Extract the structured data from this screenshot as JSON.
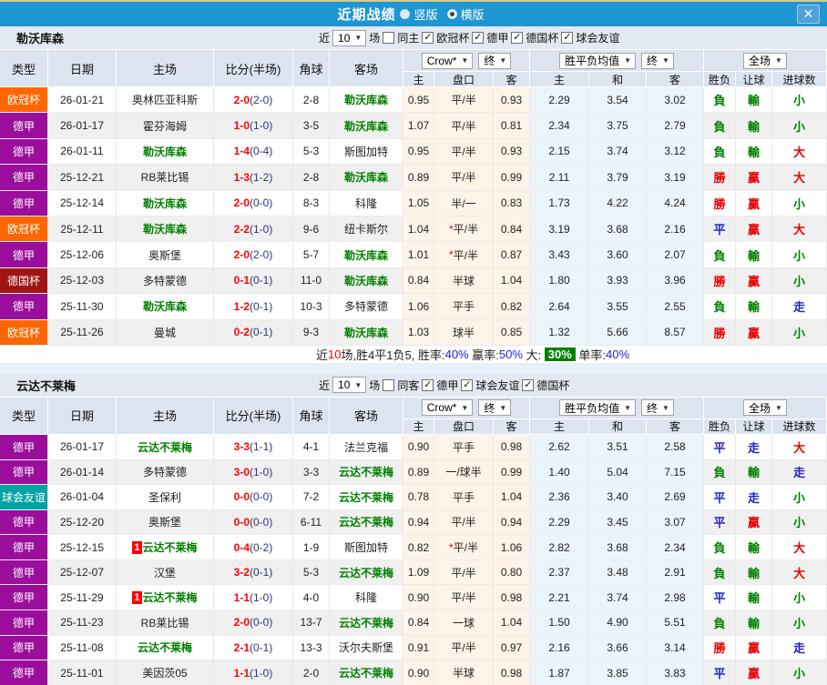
{
  "titlebar": {
    "title": "近期战绩",
    "close_glyph": "✕",
    "radios": [
      {
        "label": "竖版",
        "selected": false
      },
      {
        "label": "横版",
        "selected": true
      }
    ]
  },
  "table_columns": {
    "main": [
      "类型",
      "日期",
      "主场",
      "比分(半场)",
      "角球",
      "客场"
    ],
    "sub": [
      "主",
      "盘口",
      "客",
      "主",
      "和",
      "客",
      "胜负",
      "让球",
      "进球数"
    ]
  },
  "dropdowns": {
    "crow": "Crow*",
    "final": "终",
    "avg": "胜平负均值",
    "full": "全场"
  },
  "colors": {
    "titlebar": "#1E96D2",
    "score_red": "#FF0000",
    "half_navy": "#33337F",
    "crow_col_bg": "#FDF3E8",
    "avg_col_bg": "#EAF4FB",
    "type_colors": {
      "欧冠杯": "#FF6600",
      "德甲": "#9B0D9B",
      "德国杯": "#A01414",
      "球会友谊": "#00A3A3"
    },
    "result_colors": {
      "勝": "#E60000",
      "負": "#008000",
      "平": "#2222CC",
      "贏": "#E60000",
      "輸": "#008000",
      "走": "#2222CC",
      "大": "#E60000",
      "小": "#008000"
    }
  },
  "sections": [
    {
      "team": "勒沃库森",
      "filter": {
        "near_label": "近",
        "count": "10",
        "games_label": "场",
        "same": {
          "label": "同主",
          "checked": false
        },
        "leagues": [
          {
            "label": "欧冠杯",
            "checked": true
          },
          {
            "label": "德甲",
            "checked": true
          },
          {
            "label": "德国杯",
            "checked": true
          },
          {
            "label": "球会友谊",
            "checked": true
          }
        ]
      },
      "rows": [
        {
          "type": "欧冠杯",
          "date": "26-01-21",
          "home": "奥林匹亚科斯",
          "home_focus": false,
          "home_badge": "",
          "score": "2-0",
          "half": "(2-0)",
          "corner": "2-8",
          "away": "勒沃库森",
          "away_focus": true,
          "crow": [
            "0.95",
            "平/半",
            "0.93"
          ],
          "star": false,
          "avg": [
            "2.29",
            "3.54",
            "3.02"
          ],
          "res": "負",
          "hres": "輸",
          "goal": "小"
        },
        {
          "type": "德甲",
          "date": "26-01-17",
          "home": "霍芬海姆",
          "home_focus": false,
          "home_badge": "",
          "score": "1-0",
          "half": "(1-0)",
          "corner": "3-5",
          "away": "勒沃库森",
          "away_focus": true,
          "crow": [
            "1.07",
            "平/半",
            "0.81"
          ],
          "star": false,
          "avg": [
            "2.34",
            "3.75",
            "2.79"
          ],
          "res": "負",
          "hres": "輸",
          "goal": "小"
        },
        {
          "type": "德甲",
          "date": "26-01-11",
          "home": "勒沃库森",
          "home_focus": true,
          "home_badge": "",
          "score": "1-4",
          "half": "(0-4)",
          "corner": "5-3",
          "away": "斯图加特",
          "away_focus": false,
          "crow": [
            "0.95",
            "平/半",
            "0.93"
          ],
          "star": false,
          "avg": [
            "2.15",
            "3.74",
            "3.12"
          ],
          "res": "負",
          "hres": "輸",
          "goal": "大"
        },
        {
          "type": "德甲",
          "date": "25-12-21",
          "home": "RB莱比锡",
          "home_focus": false,
          "home_badge": "",
          "score": "1-3",
          "half": "(1-2)",
          "corner": "2-8",
          "away": "勒沃库森",
          "away_focus": true,
          "crow": [
            "0.89",
            "平/半",
            "0.99"
          ],
          "star": false,
          "avg": [
            "2.11",
            "3.79",
            "3.19"
          ],
          "res": "勝",
          "hres": "贏",
          "goal": "大"
        },
        {
          "type": "德甲",
          "date": "25-12-14",
          "home": "勒沃库森",
          "home_focus": true,
          "home_badge": "",
          "score": "2-0",
          "half": "(0-0)",
          "corner": "8-3",
          "away": "科隆",
          "away_focus": false,
          "crow": [
            "1.05",
            "半/一",
            "0.83"
          ],
          "star": false,
          "avg": [
            "1.73",
            "4.22",
            "4.24"
          ],
          "res": "勝",
          "hres": "贏",
          "goal": "小"
        },
        {
          "type": "欧冠杯",
          "date": "25-12-11",
          "home": "勒沃库森",
          "home_focus": true,
          "home_badge": "",
          "score": "2-2",
          "half": "(1-0)",
          "corner": "9-6",
          "away": "纽卡斯尔",
          "away_focus": false,
          "crow": [
            "1.04",
            "平/半",
            "0.84"
          ],
          "star": true,
          "avg": [
            "3.19",
            "3.68",
            "2.16"
          ],
          "res": "平",
          "hres": "贏",
          "goal": "大"
        },
        {
          "type": "德甲",
          "date": "25-12-06",
          "home": "奥斯堡",
          "home_focus": false,
          "home_badge": "",
          "score": "2-0",
          "half": "(2-0)",
          "corner": "5-7",
          "away": "勒沃库森",
          "away_focus": true,
          "crow": [
            "1.01",
            "平/半",
            "0.87"
          ],
          "star": true,
          "avg": [
            "3.43",
            "3.60",
            "2.07"
          ],
          "res": "負",
          "hres": "輸",
          "goal": "小"
        },
        {
          "type": "德国杯",
          "date": "25-12-03",
          "home": "多特蒙德",
          "home_focus": false,
          "home_badge": "",
          "score": "0-1",
          "half": "(0-1)",
          "corner": "11-0",
          "away": "勒沃库森",
          "away_focus": true,
          "crow": [
            "0.84",
            "半球",
            "1.04"
          ],
          "star": false,
          "avg": [
            "1.80",
            "3.93",
            "3.96"
          ],
          "res": "勝",
          "hres": "贏",
          "goal": "小"
        },
        {
          "type": "德甲",
          "date": "25-11-30",
          "home": "勒沃库森",
          "home_focus": true,
          "home_badge": "",
          "score": "1-2",
          "half": "(0-1)",
          "corner": "10-3",
          "away": "多特蒙德",
          "away_focus": false,
          "crow": [
            "1.06",
            "平手",
            "0.82"
          ],
          "star": false,
          "avg": [
            "2.64",
            "3.55",
            "2.55"
          ],
          "res": "負",
          "hres": "輸",
          "goal": "走"
        },
        {
          "type": "欧冠杯",
          "date": "25-11-26",
          "home": "曼城",
          "home_focus": false,
          "home_badge": "",
          "score": "0-2",
          "half": "(0-1)",
          "corner": "9-3",
          "away": "勒沃库森",
          "away_focus": true,
          "crow": [
            "1.03",
            "球半",
            "0.85"
          ],
          "star": false,
          "avg": [
            "1.32",
            "5.66",
            "8.57"
          ],
          "res": "勝",
          "hres": "贏",
          "goal": "小"
        }
      ],
      "summary": {
        "segments": [
          {
            "text": "近",
            "style": "plain"
          },
          {
            "text": "10",
            "style": "red"
          },
          {
            "text": "场,胜4平1负5, 胜率:",
            "style": "plain"
          },
          {
            "text": "40%",
            "style": "blue"
          },
          {
            "text": " 赢率:",
            "style": "plain"
          },
          {
            "text": "50%",
            "style": "blue"
          },
          {
            "text": " 大: ",
            "style": "plain"
          },
          {
            "text": "30%",
            "style": "highlight"
          },
          {
            "text": " 单率:",
            "style": "plain"
          },
          {
            "text": "40%",
            "style": "blue"
          }
        ]
      }
    },
    {
      "team": "云达不莱梅",
      "filter": {
        "near_label": "近",
        "count": "10",
        "games_label": "场",
        "same": {
          "label": "同客",
          "checked": false
        },
        "leagues": [
          {
            "label": "德甲",
            "checked": true
          },
          {
            "label": "球会友谊",
            "checked": true
          },
          {
            "label": "德国杯",
            "checked": true
          }
        ]
      },
      "rows": [
        {
          "type": "德甲",
          "date": "26-01-17",
          "home": "云达不莱梅",
          "home_focus": true,
          "home_badge": "",
          "score": "3-3",
          "half": "(1-1)",
          "corner": "4-1",
          "away": "法兰克福",
          "away_focus": false,
          "crow": [
            "0.90",
            "平手",
            "0.98"
          ],
          "star": false,
          "avg": [
            "2.62",
            "3.51",
            "2.58"
          ],
          "res": "平",
          "hres": "走",
          "goal": "大"
        },
        {
          "type": "德甲",
          "date": "26-01-14",
          "home": "多特蒙德",
          "home_focus": false,
          "home_badge": "",
          "score": "3-0",
          "half": "(1-0)",
          "corner": "3-3",
          "away": "云达不莱梅",
          "away_focus": true,
          "crow": [
            "0.89",
            "一/球半",
            "0.99"
          ],
          "star": false,
          "avg": [
            "1.40",
            "5.04",
            "7.15"
          ],
          "res": "負",
          "hres": "輸",
          "goal": "走"
        },
        {
          "type": "球会友谊",
          "date": "26-01-04",
          "home": "圣保利",
          "home_focus": false,
          "home_badge": "",
          "score": "0-0",
          "half": "(0-0)",
          "corner": "7-2",
          "away": "云达不莱梅",
          "away_focus": true,
          "crow": [
            "0.78",
            "平手",
            "1.04"
          ],
          "star": false,
          "avg": [
            "2.36",
            "3.40",
            "2.69"
          ],
          "res": "平",
          "hres": "走",
          "goal": "小"
        },
        {
          "type": "德甲",
          "date": "25-12-20",
          "home": "奥斯堡",
          "home_focus": false,
          "home_badge": "",
          "score": "0-0",
          "half": "(0-0)",
          "corner": "6-11",
          "away": "云达不莱梅",
          "away_focus": true,
          "crow": [
            "0.94",
            "平/半",
            "0.94"
          ],
          "star": false,
          "avg": [
            "2.29",
            "3.45",
            "3.07"
          ],
          "res": "平",
          "hres": "贏",
          "goal": "小"
        },
        {
          "type": "德甲",
          "date": "25-12-15",
          "home": "云达不莱梅",
          "home_focus": true,
          "home_badge": "1",
          "score": "0-4",
          "half": "(0-2)",
          "corner": "1-9",
          "away": "斯图加特",
          "away_focus": false,
          "crow": [
            "0.82",
            "平/半",
            "1.06"
          ],
          "star": true,
          "avg": [
            "2.82",
            "3.68",
            "2.34"
          ],
          "res": "負",
          "hres": "輸",
          "goal": "大"
        },
        {
          "type": "德甲",
          "date": "25-12-07",
          "home": "汉堡",
          "home_focus": false,
          "home_badge": "",
          "score": "3-2",
          "half": "(0-1)",
          "corner": "5-3",
          "away": "云达不莱梅",
          "away_focus": true,
          "crow": [
            "1.09",
            "平/半",
            "0.80"
          ],
          "star": false,
          "avg": [
            "2.37",
            "3.48",
            "2.91"
          ],
          "res": "負",
          "hres": "輸",
          "goal": "大"
        },
        {
          "type": "德甲",
          "date": "25-11-29",
          "home": "云达不莱梅",
          "home_focus": true,
          "home_badge": "1",
          "score": "1-1",
          "half": "(1-0)",
          "corner": "4-0",
          "away": "科隆",
          "away_focus": false,
          "crow": [
            "0.90",
            "平/半",
            "0.98"
          ],
          "star": false,
          "avg": [
            "2.21",
            "3.74",
            "2.98"
          ],
          "res": "平",
          "hres": "輸",
          "goal": "小"
        },
        {
          "type": "德甲",
          "date": "25-11-23",
          "home": "RB莱比锡",
          "home_focus": false,
          "home_badge": "",
          "score": "2-0",
          "half": "(0-0)",
          "corner": "13-7",
          "away": "云达不莱梅",
          "away_focus": true,
          "crow": [
            "0.84",
            "一球",
            "1.04"
          ],
          "star": false,
          "avg": [
            "1.50",
            "4.90",
            "5.51"
          ],
          "res": "負",
          "hres": "輸",
          "goal": "小"
        },
        {
          "type": "德甲",
          "date": "25-11-08",
          "home": "云达不莱梅",
          "home_focus": true,
          "home_badge": "",
          "score": "2-1",
          "half": "(0-1)",
          "corner": "13-3",
          "away": "沃尔夫斯堡",
          "away_focus": false,
          "crow": [
            "0.91",
            "平/半",
            "0.97"
          ],
          "star": false,
          "avg": [
            "2.16",
            "3.66",
            "3.14"
          ],
          "res": "勝",
          "hres": "贏",
          "goal": "走"
        },
        {
          "type": "德甲",
          "date": "25-11-01",
          "home": "美因茨05",
          "home_focus": false,
          "home_badge": "",
          "score": "1-1",
          "half": "(1-0)",
          "corner": "2-0",
          "away": "云达不莱梅",
          "away_focus": true,
          "crow": [
            "0.90",
            "半球",
            "0.98"
          ],
          "star": false,
          "avg": [
            "1.87",
            "3.85",
            "3.83"
          ],
          "res": "平",
          "hres": "贏",
          "goal": "小"
        }
      ],
      "summary": null
    }
  ]
}
